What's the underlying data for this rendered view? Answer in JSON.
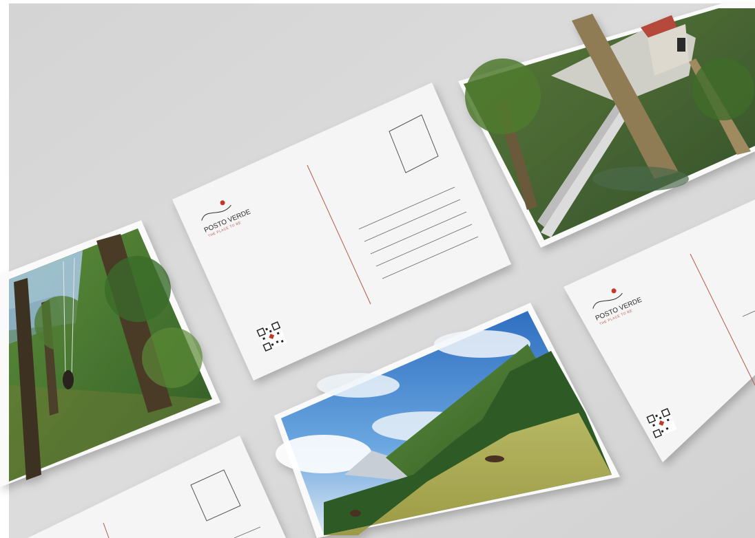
{
  "scene": {
    "colors": {
      "frame_background": "#ffffff",
      "table_surface": "#d9d9d9",
      "postcard_paper": "#f5f5f5",
      "photo_border": "#fafafa",
      "divider_line": "#b5574b",
      "address_line": "#666666",
      "brand_mark": "#c0392b",
      "brand_text": "#2b2b2b",
      "sky_blue": "#3a7fc9",
      "forest_green": "#3f6b2c",
      "meadow": "#b9b25c"
    },
    "postcards": [
      {
        "side": "back",
        "brand_name": "POSTO VERDE",
        "tagline": "THE PLACE TO BE",
        "has_stamp_box": true,
        "address_lines": 5,
        "has_qr_code": true
      },
      {
        "side": "back",
        "brand_name": "POSTO VERDE",
        "tagline": "THE PLACE TO BE",
        "has_stamp_box": false,
        "address_lines": 1,
        "has_qr_code": true
      },
      {
        "side": "back",
        "has_stamp_box": true,
        "address_lines": 1,
        "has_qr_code": false
      },
      {
        "side": "front",
        "photo": "forest-swing"
      },
      {
        "side": "front",
        "photo": "suspension-bridge-with-chapel"
      },
      {
        "side": "front",
        "photo": "mountain-meadow-with-horses"
      }
    ]
  }
}
